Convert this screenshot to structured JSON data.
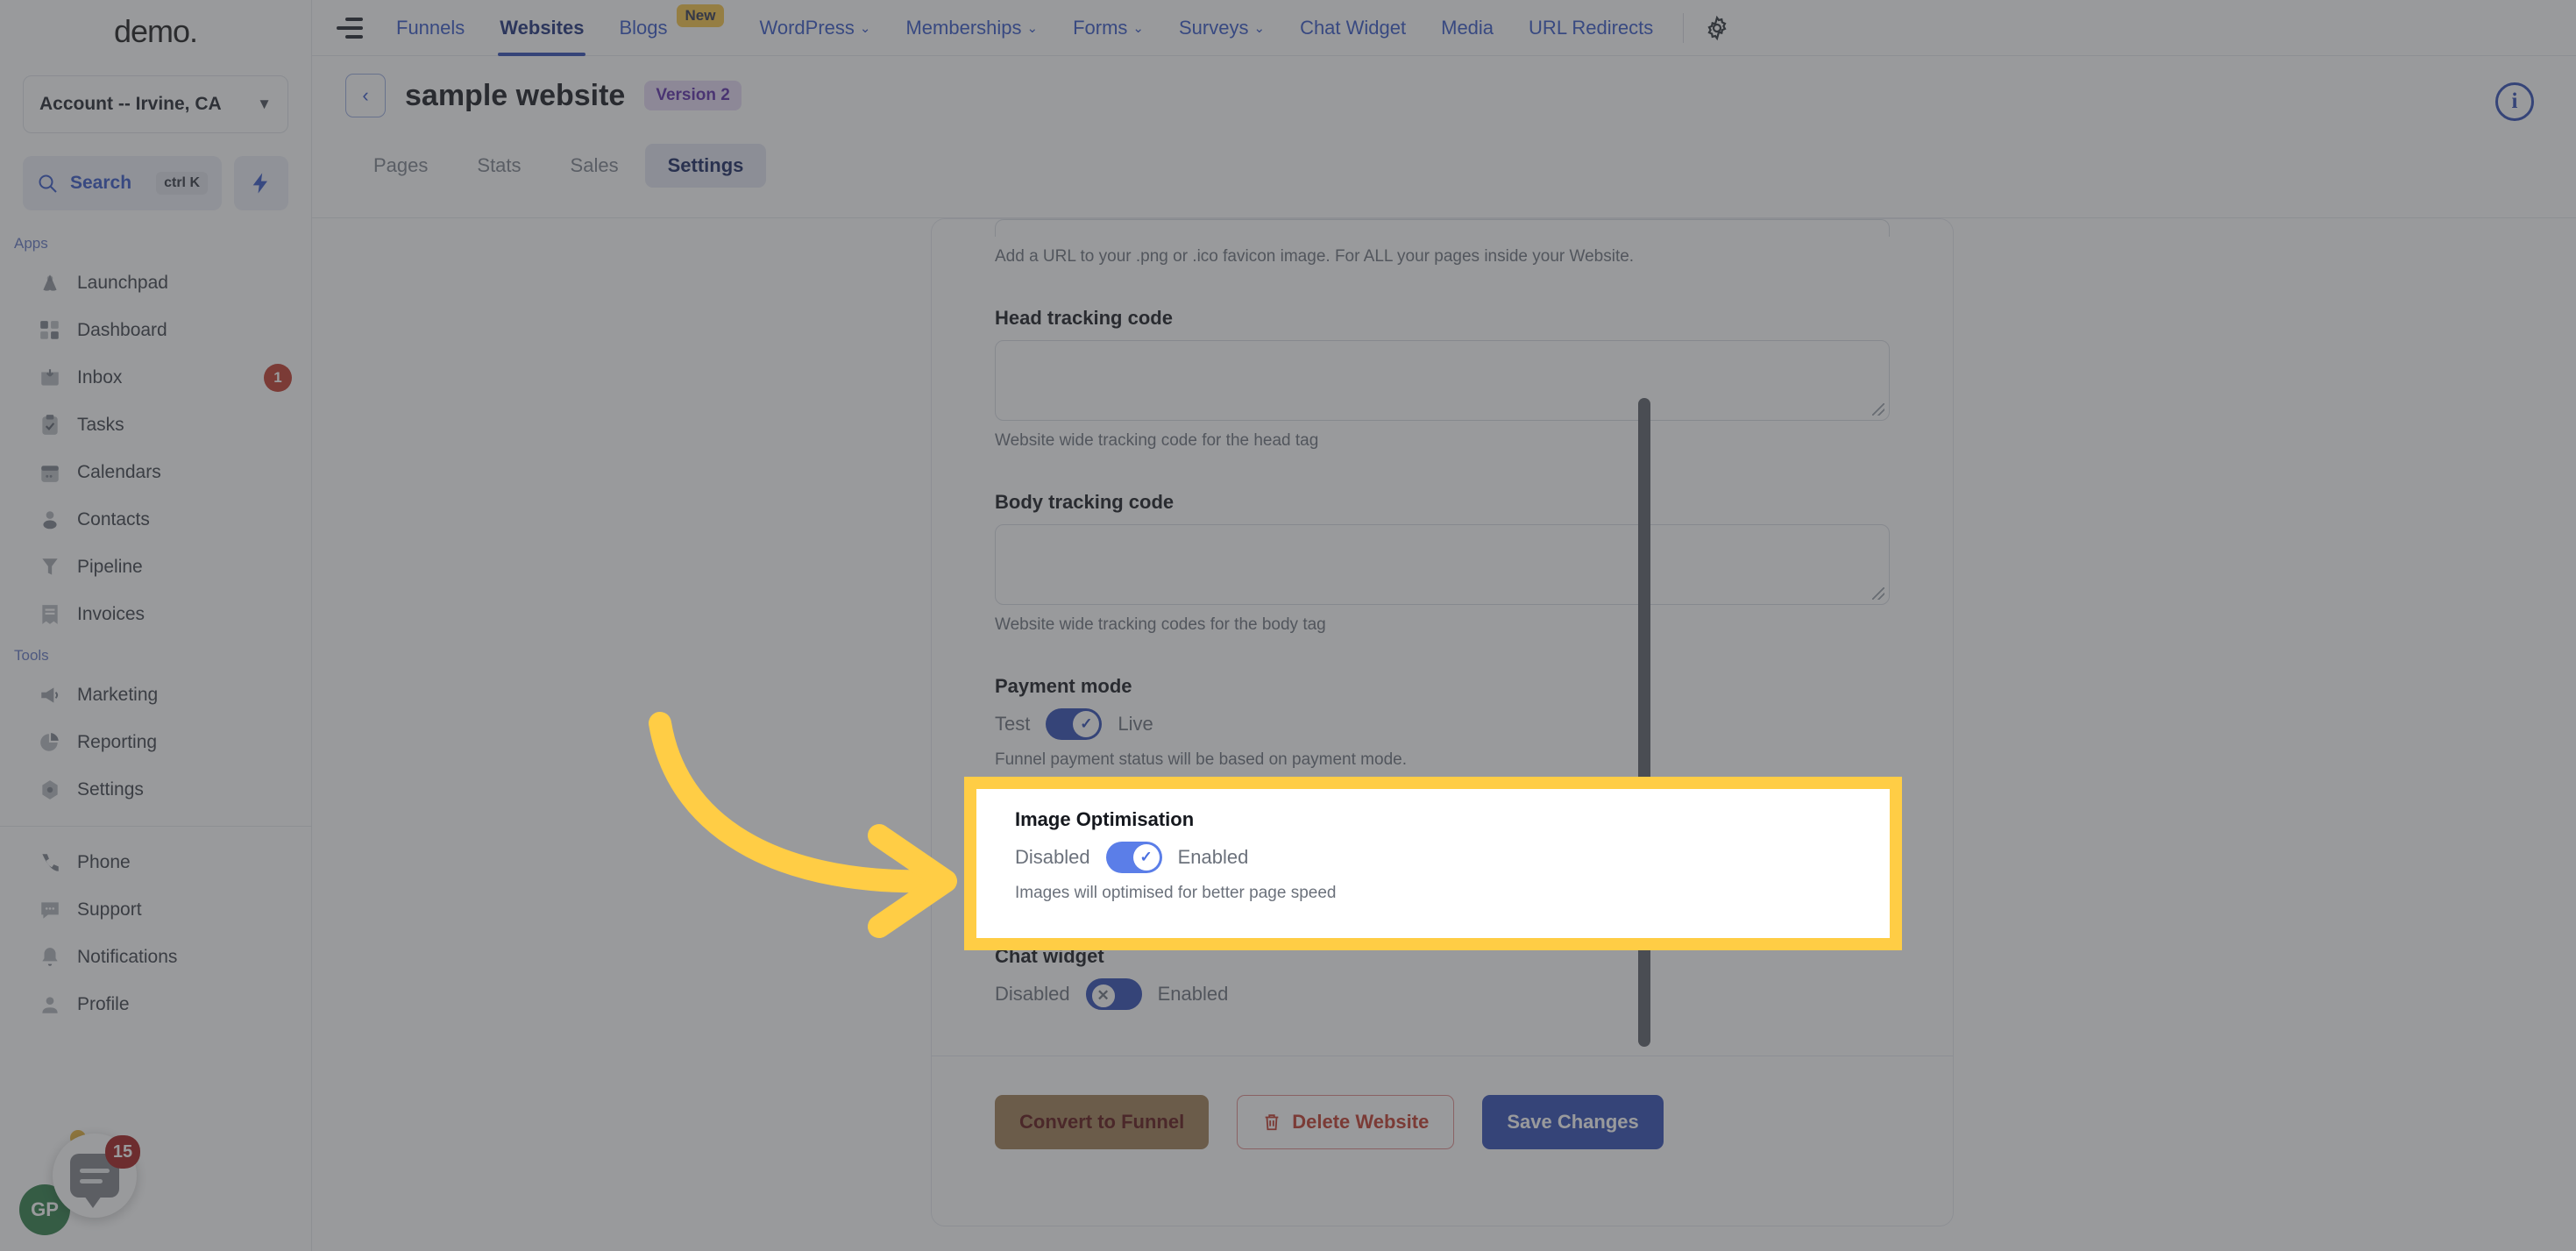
{
  "sidebar": {
    "brand": "demo",
    "brand_dot": ".",
    "account_selector": {
      "label": "Account -- Irvine, CA",
      "chevron": "chevron-down"
    },
    "search": {
      "label": "Search",
      "shortcut": "ctrl K"
    },
    "groups": [
      {
        "label": "Apps",
        "items": [
          {
            "label": "Launchpad",
            "icon": "launchpad-icon",
            "badge": ""
          },
          {
            "label": "Dashboard",
            "icon": "dashboard-icon",
            "badge": ""
          },
          {
            "label": "Inbox",
            "icon": "inbox-icon",
            "badge": "1"
          },
          {
            "label": "Tasks",
            "icon": "tasks-icon",
            "badge": ""
          },
          {
            "label": "Calendars",
            "icon": "calendar-icon",
            "badge": ""
          },
          {
            "label": "Contacts",
            "icon": "contacts-icon",
            "badge": ""
          },
          {
            "label": "Pipeline",
            "icon": "pipeline-icon",
            "badge": ""
          },
          {
            "label": "Invoices",
            "icon": "invoices-icon",
            "badge": ""
          }
        ]
      },
      {
        "label": "Tools",
        "items": [
          {
            "label": "Marketing",
            "icon": "megaphone-icon",
            "badge": ""
          },
          {
            "label": "Reporting",
            "icon": "piechart-icon",
            "badge": ""
          },
          {
            "label": "Settings",
            "icon": "gear-icon",
            "badge": ""
          }
        ]
      }
    ],
    "bottom_items": [
      {
        "label": "Phone",
        "icon": "phone-icon"
      },
      {
        "label": "Support",
        "icon": "chat-dots-icon"
      },
      {
        "label": "Notifications",
        "icon": "bell-icon"
      },
      {
        "label": "Profile",
        "icon": "user-icon"
      }
    ],
    "fab": {
      "badge": "15",
      "icon": "chat-bubble-icon"
    },
    "avatar": {
      "initials": "GP"
    }
  },
  "topnav": {
    "collapse_icon": "collapse-sidebar-icon",
    "items": [
      {
        "label": "Funnels",
        "caret": false,
        "active": false,
        "badge": ""
      },
      {
        "label": "Websites",
        "caret": false,
        "active": true,
        "badge": ""
      },
      {
        "label": "Blogs",
        "caret": false,
        "active": false,
        "badge": "New"
      },
      {
        "label": "WordPress",
        "caret": true,
        "active": false,
        "badge": ""
      },
      {
        "label": "Memberships",
        "caret": true,
        "active": false,
        "badge": ""
      },
      {
        "label": "Forms",
        "caret": true,
        "active": false,
        "badge": ""
      },
      {
        "label": "Surveys",
        "caret": true,
        "active": false,
        "badge": ""
      },
      {
        "label": "Chat Widget",
        "caret": false,
        "active": false,
        "badge": ""
      },
      {
        "label": "Media",
        "caret": false,
        "active": false,
        "badge": ""
      },
      {
        "label": "URL Redirects",
        "caret": false,
        "active": false,
        "badge": ""
      }
    ],
    "caret_glyph": "⌄",
    "gear_icon": "gear-icon"
  },
  "page_header": {
    "back_glyph": "‹",
    "title": "sample website",
    "version_badge": "Version 2",
    "info_glyph": "i",
    "subtabs": [
      {
        "label": "Pages",
        "active": false
      },
      {
        "label": "Stats",
        "active": false
      },
      {
        "label": "Sales",
        "active": false
      },
      {
        "label": "Settings",
        "active": true
      }
    ]
  },
  "settings_form": {
    "favicon_help": "Add a URL to your .png or .ico favicon image. For ALL your pages inside your Website.",
    "head_tracking": {
      "label": "Head tracking code",
      "value": "",
      "help": "Website wide tracking code for the head tag"
    },
    "body_tracking": {
      "label": "Body tracking code",
      "value": "",
      "help": "Website wide tracking codes for the body tag"
    },
    "payment_mode": {
      "label": "Payment mode",
      "off_label": "Test",
      "on_label": "Live",
      "state": "on",
      "help": "Funnel payment status will be based on payment mode."
    },
    "image_optimisation": {
      "label": "Image Optimisation",
      "off_label": "Disabled",
      "on_label": "Enabled",
      "state": "on",
      "help": "Images will optimised for better page speed"
    },
    "chat_widget": {
      "label": "Chat widget",
      "off_label": "Disabled",
      "on_label": "Enabled",
      "state": "off"
    },
    "footer_buttons": {
      "convert": "Convert to Funnel",
      "delete": "Delete Website",
      "delete_icon": "trash-icon",
      "save": "Save Changes"
    }
  },
  "annotation": {
    "highlight_color": "#ffcd45",
    "arrow_color": "#ffcd45",
    "target": "image-optimisation-section"
  }
}
